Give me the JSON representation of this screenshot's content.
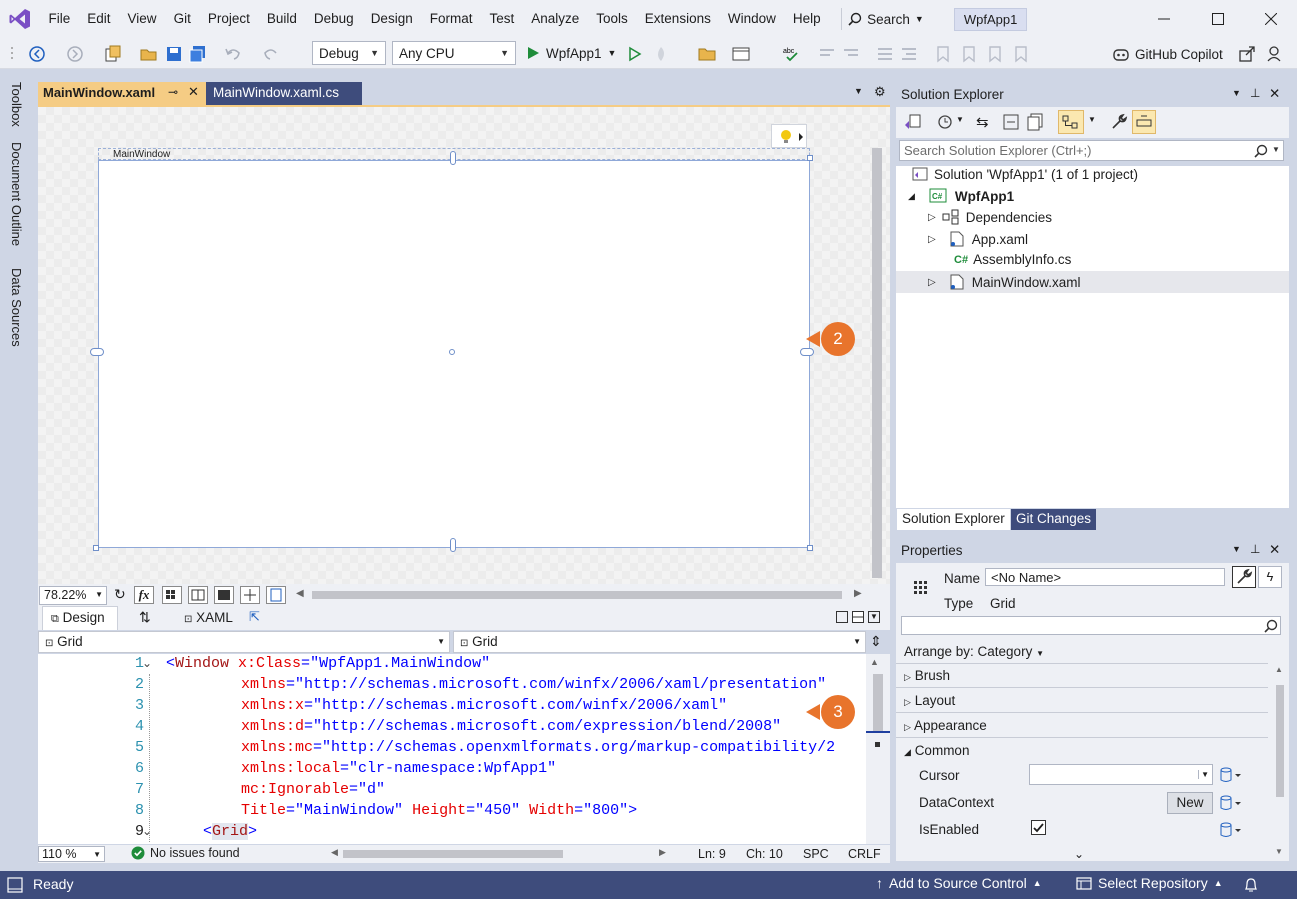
{
  "menu": {
    "items": [
      "File",
      "Edit",
      "View",
      "Git",
      "Project",
      "Build",
      "Debug",
      "Design",
      "Format",
      "Test",
      "Analyze",
      "Tools",
      "Extensions",
      "Window",
      "Help"
    ],
    "search_label": "Search",
    "solution_name": "WpfApp1"
  },
  "toolbar": {
    "configuration": "Debug",
    "platform": "Any CPU",
    "start_label": "WpfApp1",
    "copilot_label": "GitHub Copilot"
  },
  "side_tabs": [
    "Toolbox",
    "Document Outline",
    "Data Sources"
  ],
  "doc_tabs": {
    "active": "MainWindow.xaml",
    "other": "MainWindow.xaml.cs"
  },
  "designer": {
    "window_title": "MainWindow",
    "zoom": "78.22%",
    "fx_label": "fx",
    "design_tab": "Design",
    "xaml_tab": "XAML",
    "callout_2": "2",
    "callout_3": "3"
  },
  "nav": {
    "left_combo": "Grid",
    "right_combo": "Grid"
  },
  "editor": {
    "line_numbers": [
      "1",
      "2",
      "3",
      "4",
      "5",
      "6",
      "7",
      "8",
      "9"
    ],
    "zoom": "110 %",
    "issues": "No issues found",
    "line": "Ln: 9",
    "col": "Ch: 10",
    "spc": "SPC",
    "crlf": "CRLF"
  },
  "code": {
    "l1": {
      "bracket": "<",
      "tag": "Window",
      "attr": " x:Class",
      "eq": "=",
      "val": "\"WpfApp1.MainWindow\""
    },
    "l2": {
      "attr": "xmlns",
      "eq": "=",
      "val": "\"http://schemas.microsoft.com/winfx/2006/xaml/presentation\""
    },
    "l3": {
      "attr": "xmlns:x",
      "eq": "=",
      "val": "\"http://schemas.microsoft.com/winfx/2006/xaml\""
    },
    "l4": {
      "attr": "xmlns:d",
      "eq": "=",
      "val": "\"http://schemas.microsoft.com/expression/blend/2008\""
    },
    "l5": {
      "attr": "xmlns:mc",
      "eq": "=",
      "val": "\"http://schemas.openxmlformats.org/markup-compatibility/2"
    },
    "l6": {
      "attr": "xmlns:local",
      "eq": "=",
      "val": "\"clr-namespace:WpfApp1\""
    },
    "l7": {
      "attr": "mc:Ignorable",
      "eq": "=",
      "val": "\"d\""
    },
    "l8": {
      "attr1": "Title",
      "val1": "\"MainWindow\"",
      "attr2": " Height",
      "val2": "\"450\"",
      "attr3": " Width",
      "val3": "\"800\"",
      "close": ">"
    },
    "l9": {
      "bracket": "<",
      "tag": "Grid",
      "close": ">"
    }
  },
  "solution_explorer": {
    "title": "Solution Explorer",
    "search_placeholder": "Search Solution Explorer (Ctrl+;)",
    "solution": "Solution 'WpfApp1' (1 of 1 project)",
    "project": "WpfApp1",
    "items": [
      "Dependencies",
      "App.xaml",
      "AssemblyInfo.cs",
      "MainWindow.xaml"
    ],
    "tab_active": "Solution Explorer",
    "tab_other": "Git Changes"
  },
  "properties": {
    "title": "Properties",
    "name_label": "Name",
    "name_value": "<No Name>",
    "type_label": "Type",
    "type_value": "Grid",
    "arrange_by": "Arrange by: Category",
    "categories": [
      "Brush",
      "Layout",
      "Appearance",
      "Common"
    ],
    "cursor_label": "Cursor",
    "datacontext_label": "DataContext",
    "new_button": "New",
    "isenabled_label": "IsEnabled",
    "isenabled_checked": true
  },
  "statusbar": {
    "ready": "Ready",
    "source_control": "Add to Source Control",
    "repository": "Select Repository"
  },
  "colors": {
    "accent": "#3e4c7c",
    "active_tab": "#f5cc84",
    "callout": "#e8742c",
    "vs_purple": "#7a4fc4"
  }
}
